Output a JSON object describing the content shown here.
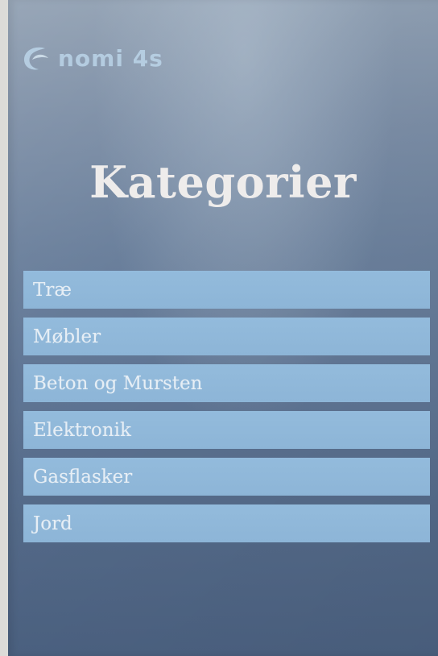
{
  "logo": {
    "icon": "crescent-swirl-icon",
    "text": "nomi 4s",
    "tagline": ""
  },
  "title": "Kategorier",
  "categories": [
    {
      "label": "Træ"
    },
    {
      "label": "Møbler"
    },
    {
      "label": "Beton og Mursten"
    },
    {
      "label": "Elektronik"
    },
    {
      "label": "Gasflasker"
    },
    {
      "label": "Jord"
    }
  ],
  "colors": {
    "sign_top": "#8d9db0",
    "sign_bottom": "#4c6282",
    "item_fill": "#8fb7d9",
    "title_text": "#eeeceb",
    "logo": "#b9d2e6"
  }
}
